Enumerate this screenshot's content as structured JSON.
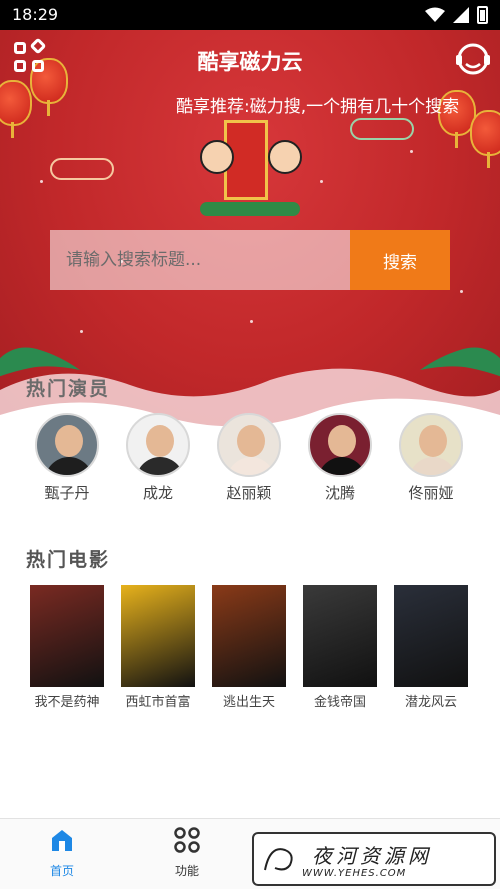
{
  "status_bar": {
    "time": "18:29"
  },
  "header": {
    "title": "酷享磁力云",
    "marquee": "酷享推荐:磁力搜,一个拥有几十个搜索"
  },
  "search": {
    "placeholder": "请输入搜索标题...",
    "button_label": "搜索"
  },
  "sections": {
    "actors_title": "热门演员",
    "movies_title": "热门电影"
  },
  "actors": [
    {
      "name": "甄子丹"
    },
    {
      "name": "成龙"
    },
    {
      "name": "赵丽颖"
    },
    {
      "name": "沈腾"
    },
    {
      "name": "佟丽娅"
    }
  ],
  "movies": [
    {
      "title": "我不是药神",
      "poster_color": "#7a2a22"
    },
    {
      "title": "西虹市首富",
      "poster_color": "#e7b21c"
    },
    {
      "title": "逃出生天",
      "poster_color": "#8a3a18"
    },
    {
      "title": "金钱帝国",
      "poster_color": "#3a3a3a"
    },
    {
      "title": "潜龙风云",
      "poster_color": "#2a2f3a"
    }
  ],
  "tabs": [
    {
      "label": "首页",
      "icon": "home-icon"
    },
    {
      "label": "功能",
      "icon": "grid-icon"
    }
  ],
  "watermark": {
    "title": "夜河资源网",
    "url": "WWW.YEHES.COM"
  },
  "colors": {
    "accent": "#f07a18",
    "hero_red": "#c1282a",
    "tab_active": "#1e88e5"
  }
}
